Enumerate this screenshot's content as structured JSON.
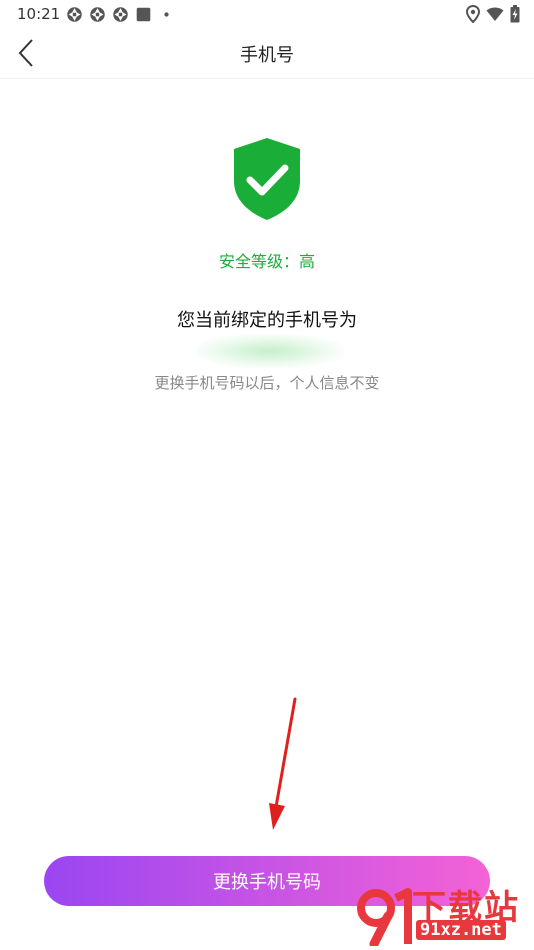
{
  "status_bar": {
    "time": "10:21",
    "left_icons": [
      "aperture-icon",
      "aperture-icon",
      "aperture-icon",
      "square-notification-icon",
      "dot-icon"
    ],
    "right_icons": [
      "location-icon",
      "wifi-icon",
      "battery-charging-icon"
    ]
  },
  "header": {
    "title": "手机号",
    "back_icon": "chevron-left-icon"
  },
  "security": {
    "level_text": "安全等级：高",
    "shield_color": "#1aad38",
    "level_color": "#1aad38"
  },
  "binding": {
    "label": "您当前绑定的手机号为",
    "hint": "更换手机号码以后，个人信息不变"
  },
  "action": {
    "change_label": "更换手机号码",
    "gradient_start": "#9a46f2",
    "gradient_end": "#f462d6"
  },
  "watermark": {
    "cn_text": "下载站",
    "url_text": "91xz.net",
    "color": "#e8383d"
  }
}
